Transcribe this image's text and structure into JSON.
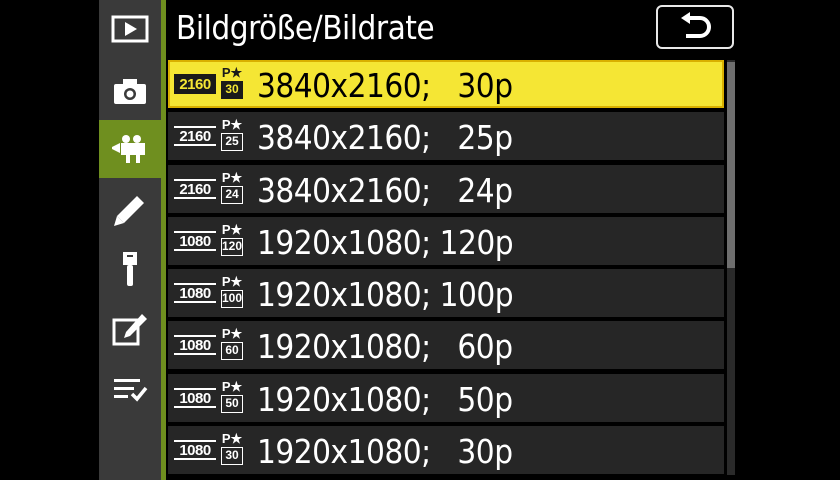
{
  "header": {
    "title": "Bildgröße/Bildrate",
    "back_icon": "return-arrow-icon"
  },
  "sidebar": {
    "tabs": [
      {
        "name": "playback",
        "icon": "play-icon",
        "active": false
      },
      {
        "name": "photo-shooting",
        "icon": "camera-icon",
        "active": false
      },
      {
        "name": "movie-shooting",
        "icon": "movie-camera-icon",
        "active": true
      },
      {
        "name": "custom-settings",
        "icon": "pencil-icon",
        "active": false
      },
      {
        "name": "setup",
        "icon": "wrench-icon",
        "active": false
      },
      {
        "name": "retouch",
        "icon": "retouch-icon",
        "active": false
      },
      {
        "name": "my-menu",
        "icon": "my-menu-icon",
        "active": false
      }
    ],
    "accent_color": "#6f8f1f"
  },
  "list": {
    "items": [
      {
        "res_badge": "2160",
        "pstar": "P★",
        "fr_badge": "30",
        "label": "3840x2160;   30p",
        "selected": true
      },
      {
        "res_badge": "2160",
        "pstar": "P★",
        "fr_badge": "25",
        "label": "3840x2160;   25p",
        "selected": false
      },
      {
        "res_badge": "2160",
        "pstar": "P★",
        "fr_badge": "24",
        "label": "3840x2160;   24p",
        "selected": false
      },
      {
        "res_badge": "1080",
        "pstar": "P★",
        "fr_badge": "120",
        "label": "1920x1080; 120p",
        "selected": false
      },
      {
        "res_badge": "1080",
        "pstar": "P★",
        "fr_badge": "100",
        "label": "1920x1080; 100p",
        "selected": false
      },
      {
        "res_badge": "1080",
        "pstar": "P★",
        "fr_badge": "60",
        "label": "1920x1080;   60p",
        "selected": false
      },
      {
        "res_badge": "1080",
        "pstar": "P★",
        "fr_badge": "50",
        "label": "1920x1080;   50p",
        "selected": false
      },
      {
        "res_badge": "1080",
        "pstar": "P★",
        "fr_badge": "30",
        "label": "1920x1080;   30p",
        "selected": false
      }
    ],
    "highlight_color": "#f5e634"
  },
  "scrollbar": {
    "position_fraction": 0.0,
    "visible_fraction": 0.5
  }
}
